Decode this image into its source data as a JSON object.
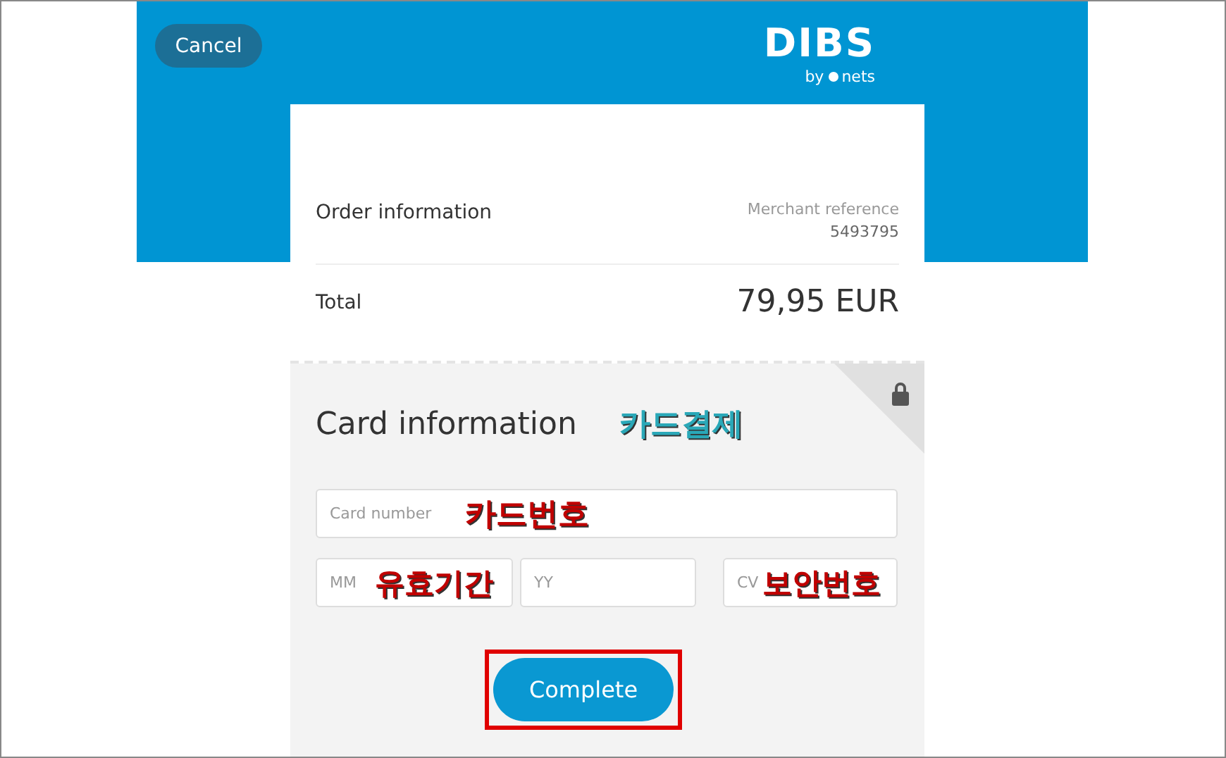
{
  "header": {
    "cancel_button": "Cancel",
    "logo": {
      "name": "DIBS",
      "tagline_prefix": "by",
      "tagline_brand": "nets"
    }
  },
  "order": {
    "title": "Order information",
    "reference_label": "Merchant reference",
    "reference_value": "5493795",
    "total_label": "Total",
    "total_value": "79,95 EUR"
  },
  "card": {
    "title": "Card information",
    "title_annotation": {
      "text": "카드결제",
      "color": "#2aa8b8"
    },
    "locked": true,
    "fields": [
      {
        "placeholder": "Card number",
        "annotation": {
          "text": "카드번호",
          "color": "#c00000"
        }
      },
      {
        "placeholder": "MM",
        "annotation": {
          "text": "유효기간",
          "color": "#c00000"
        }
      },
      {
        "placeholder": "YY"
      },
      {
        "placeholder": "CV",
        "annotation": {
          "text": "보안번호",
          "color": "#c00000"
        }
      }
    ],
    "submit": {
      "label": "Complete",
      "highlighted": true
    }
  }
}
